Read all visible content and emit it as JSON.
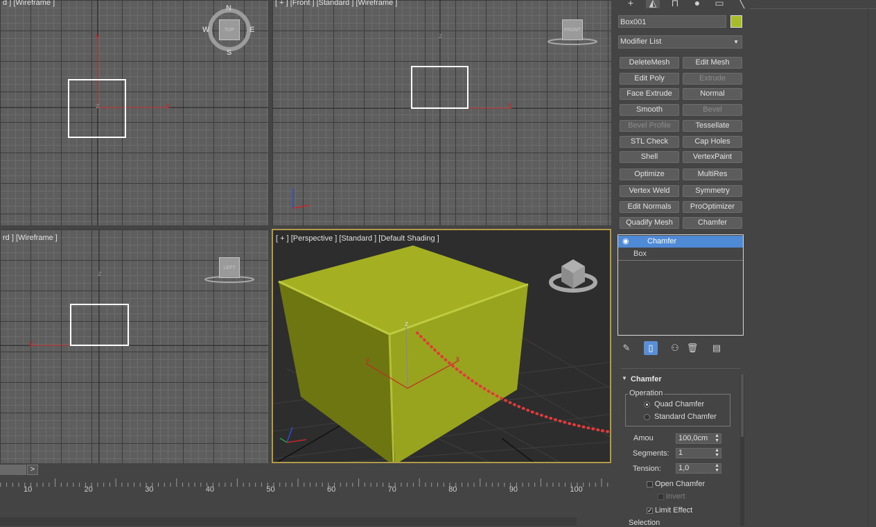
{
  "viewports": {
    "top": {
      "label": "d ] [Wireframe ]"
    },
    "front": {
      "label": "[ + ] [Front ] [Standard ] [Wireframe ]"
    },
    "left": {
      "label": "rd ] [Wireframe ]"
    },
    "perspective": {
      "label": "[ + ] [Perspective ] [Standard ] [Default Shading ]"
    }
  },
  "viewcube": {
    "top_face": "TOP",
    "front_face": "FRONT",
    "left_face": "LEFT",
    "compass": {
      "n": "N",
      "s": "S",
      "e": "E",
      "w": "W"
    }
  },
  "axes": {
    "x": "x",
    "y": "y",
    "z": "z"
  },
  "panel": {
    "object_name": "Box001",
    "object_color": "#a8bb2a",
    "modifier_list": "Modifier List",
    "buttons": [
      {
        "label": "DeleteMesh",
        "enabled": true
      },
      {
        "label": "Edit Mesh",
        "enabled": true
      },
      {
        "label": "Edit Poly",
        "enabled": true
      },
      {
        "label": "Extrude",
        "enabled": false
      },
      {
        "label": "Face Extrude",
        "enabled": true
      },
      {
        "label": "Normal",
        "enabled": true
      },
      {
        "label": "Smooth",
        "enabled": true
      },
      {
        "label": "Bevel",
        "enabled": false
      },
      {
        "label": "Bevel Profile",
        "enabled": false
      },
      {
        "label": "Tessellate",
        "enabled": true
      },
      {
        "label": "STL Check",
        "enabled": true
      },
      {
        "label": "Cap Holes",
        "enabled": true
      },
      {
        "label": "Shell",
        "enabled": true
      },
      {
        "label": "VertexPaint",
        "enabled": true
      },
      {
        "label": "Optimize",
        "enabled": true
      },
      {
        "label": "MultiRes",
        "enabled": true
      },
      {
        "label": "Vertex Weld",
        "enabled": true
      },
      {
        "label": "Symmetry",
        "enabled": true
      },
      {
        "label": "Edit Normals",
        "enabled": true
      },
      {
        "label": "ProOptimizer",
        "enabled": true
      },
      {
        "label": "Quadify Mesh",
        "enabled": true
      },
      {
        "label": "Chamfer",
        "enabled": true
      }
    ],
    "stack": [
      {
        "label": "Chamfer",
        "selected": true
      },
      {
        "label": "Box",
        "selected": false
      }
    ],
    "rollout": {
      "title": "Chamfer",
      "operation_group": "Operation",
      "options": [
        {
          "label": "Quad Chamfer",
          "checked": true
        },
        {
          "label": "Standard Chamfer",
          "checked": false
        }
      ],
      "amount_label": "Amou",
      "amount_value": "100,0cm",
      "segments_label": "Segments:",
      "segments_value": "1",
      "tension_label": "Tension:",
      "tension_value": "1,0",
      "open_chamfer": "Open Chamfer",
      "invert": "Invert",
      "limit_effect": "Limit Effect",
      "selection": "Selection"
    }
  },
  "timeline": {
    "next": ">",
    "ticks": [
      "10",
      "20",
      "30",
      "40",
      "50",
      "60",
      "70",
      "80",
      "90",
      "100"
    ]
  }
}
